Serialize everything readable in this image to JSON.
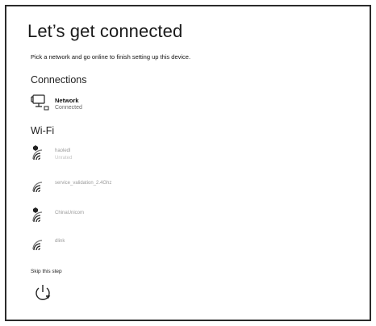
{
  "page": {
    "title": "Let’s get connected",
    "subtitle": "Pick a network and go online to finish setting up this device."
  },
  "connections": {
    "heading": "Connections",
    "items": [
      {
        "name": "Network",
        "status": "Connected",
        "icon": "ethernet-monitor-icon"
      }
    ]
  },
  "wifi": {
    "heading": "Wi-Fi",
    "networks": [
      {
        "ssid": "haoledl",
        "status": "Unrated",
        "secured": true
      },
      {
        "ssid": "service_validation_2.4Ghz",
        "secured": false
      },
      {
        "ssid": "ChinaUnicom",
        "secured": true
      },
      {
        "ssid": "dlink",
        "secured": false
      }
    ]
  },
  "footer": {
    "skip_label": "Skip this step",
    "restart_icon": "power-restart-icon"
  }
}
